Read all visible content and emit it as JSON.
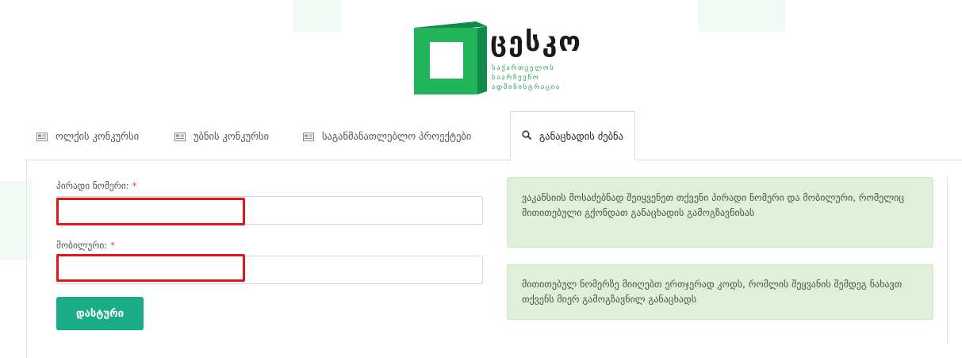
{
  "logo": {
    "title": "ცესკო",
    "subtitle_lines": [
      "საქართველოს",
      "საარჩევნო",
      "ადმინისტრაცია"
    ]
  },
  "tabs": [
    {
      "label": "ოლქის კონკურსი",
      "icon": "newspaper-icon"
    },
    {
      "label": "უბნის კონკურსი",
      "icon": "newspaper-icon"
    },
    {
      "label": "საგანმანათლებლო პროექტები",
      "icon": "newspaper-icon"
    },
    {
      "label": "განაცხადის ძებნა",
      "icon": "search-icon",
      "active": true
    }
  ],
  "form": {
    "personal_number_label": "პირადი ნომერი:",
    "personal_number_value": "",
    "mobile_label": "მობილური:",
    "mobile_value": "",
    "required_mark": "*",
    "submit_label": "დასტური"
  },
  "info": {
    "message_1": "ვაკანსიის მოსაძებნად შეიყვენეთ თქვენი პირადი ნომერი და მობილური, რომელიც მითითებული გქონდათ განაცხადის გამოგზავნისას",
    "message_2": "მითითებულ ნომერზე მიიღებთ ერთჯერად კოდს, რომლის შეყვანის შემდეგ ნახავთ თქვენს მიერ გამოგზავნილ განაცხადს"
  },
  "colors": {
    "brand_green": "#1aab55",
    "button_teal": "#1aab87",
    "highlight_red": "#e3141a",
    "info_bg": "#dff0d8",
    "required_red": "#e03b3b"
  }
}
